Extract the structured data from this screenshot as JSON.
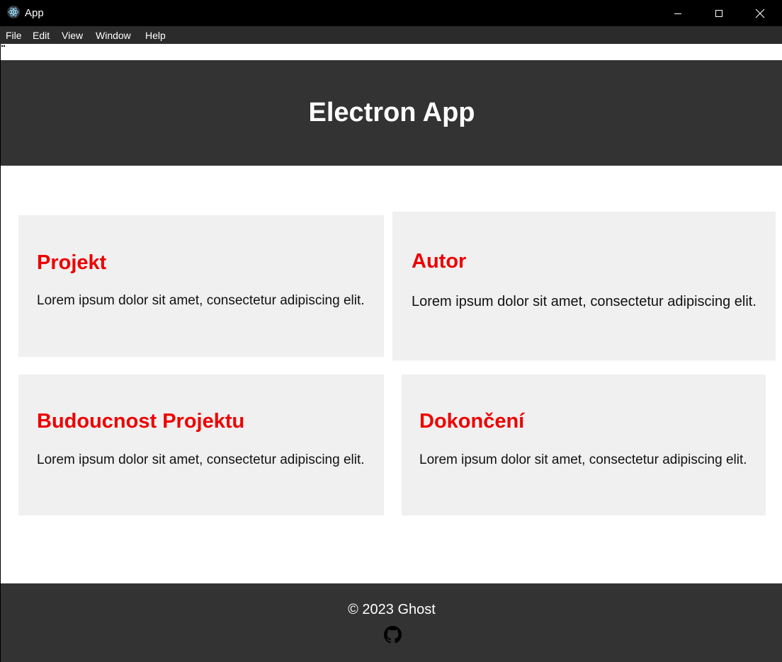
{
  "window": {
    "title": "App"
  },
  "menu": [
    "File",
    "Edit",
    "View",
    "Window",
    "Help"
  ],
  "header": {
    "title": "Electron App"
  },
  "cards": [
    {
      "title": "Projekt",
      "text": "Lorem ipsum dolor sit amet, consectetur adipiscing elit."
    },
    {
      "title": "Autor",
      "text": "Lorem ipsum dolor sit amet, consectetur adipiscing elit."
    },
    {
      "title": "Budoucnost Projektu",
      "text": "Lorem ipsum dolor sit amet, consectetur adipiscing elit."
    },
    {
      "title": "Dokončení",
      "text": "Lorem ipsum dolor sit amet, consectetur adipiscing elit."
    }
  ],
  "footer": {
    "copyright": "© 2023 Ghost",
    "icon": "github-icon"
  },
  "colors": {
    "header_bg": "#333333",
    "card_bg": "#f0f0f0",
    "card_title": "#ee0000",
    "titlebar_bg": "#000000",
    "menubar_bg": "#2b2b2b"
  }
}
